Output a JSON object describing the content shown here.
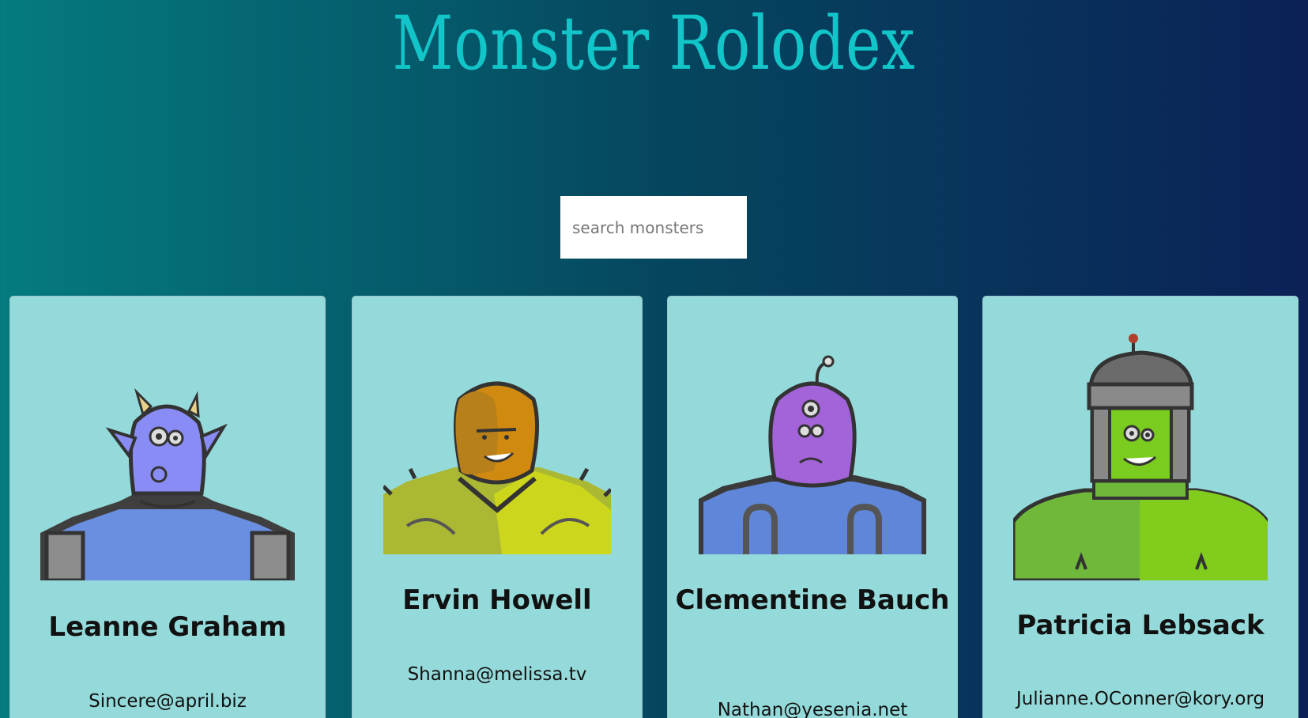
{
  "app": {
    "title": "Monster Rolodex"
  },
  "search": {
    "placeholder": "search monsters",
    "value": ""
  },
  "monsters": [
    {
      "name": "Leanne Graham",
      "email": "Sincere@april.biz"
    },
    {
      "name": "Ervin Howell",
      "email": "Shanna@melissa.tv"
    },
    {
      "name": "Clementine Bauch",
      "email": "Nathan@yesenia.net"
    },
    {
      "name": "Patricia Lebsack",
      "email": "Julianne.OConner@kory.org"
    }
  ],
  "colors": {
    "title": "#11c5c8",
    "card_background": "#95dada",
    "gradient_left": "#057b7f",
    "gradient_right": "#0b2157"
  }
}
